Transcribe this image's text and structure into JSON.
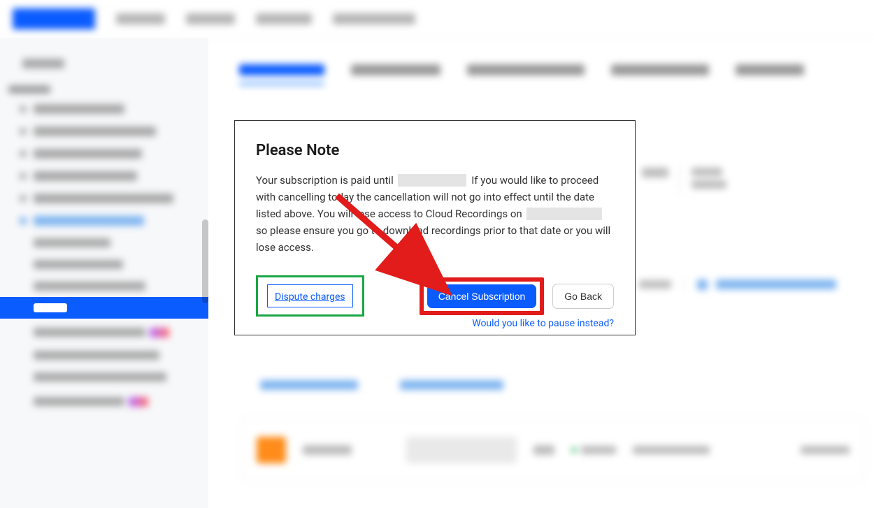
{
  "dialog": {
    "title": "Please Note",
    "text_part1": "Your subscription is paid until",
    "text_part2": "If you would like to proceed with cancelling today the cancellation will not go into effect until the date listed above. You will lose access to Cloud Recordings on",
    "text_part3": "so please ensure you go to download recordings prior to that date or you will lose access.",
    "dispute_label": "Dispute charges",
    "cancel_label": "Cancel Subscription",
    "goback_label": "Go Back",
    "pause_label": "Would you like to pause instead?"
  },
  "annotations": {
    "arrow_color": "#e21b1b",
    "dispute_highlight_color": "#19a645",
    "cancel_highlight_color": "#e21b1b"
  }
}
